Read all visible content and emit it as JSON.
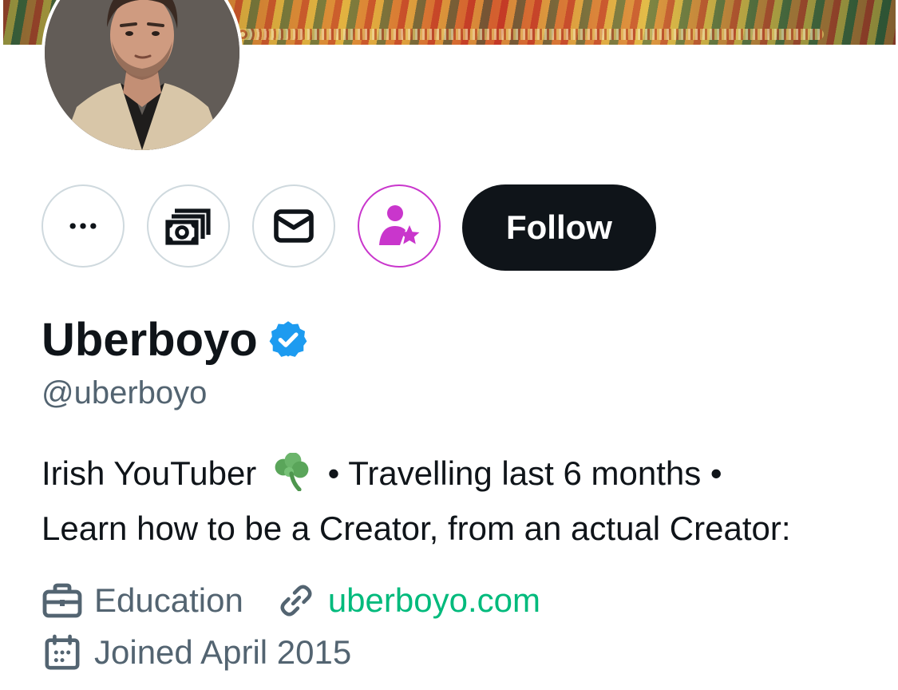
{
  "profile": {
    "display_name": "Uberboyo",
    "handle": "@uberboyo",
    "verified": true,
    "bio": {
      "line1_text": "Irish YouTuber",
      "line1_emoji": "☘️",
      "line1_rest": "• Travelling last 6 months •",
      "line2": "Learn how to be a Creator, from an actual Creator:"
    },
    "category": "Education",
    "website": "uberboyo.com",
    "joined": "Joined April 2015"
  },
  "actions": {
    "more_icon": "more-horizontal-icon",
    "tip_icon": "money-icon",
    "message_icon": "envelope-icon",
    "subscribe_icon": "person-star-icon",
    "follow_label": "Follow"
  },
  "colors": {
    "text": "#0f1419",
    "secondary": "#536471",
    "verified": "#1d9bf0",
    "subscribe": "#c936cc",
    "link": "#00ba7c",
    "follow_bg": "#0f1419"
  }
}
